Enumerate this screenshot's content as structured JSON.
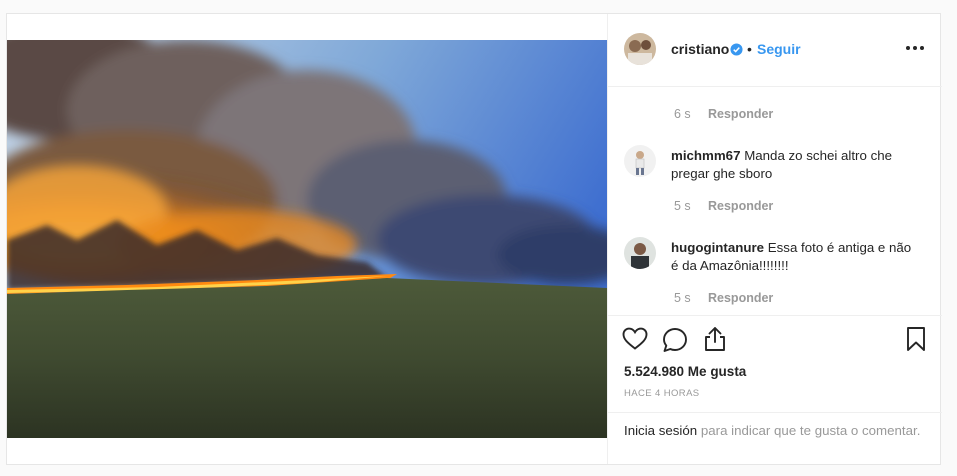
{
  "post": {
    "author": "cristiano",
    "follow_label": "Seguir",
    "dot": "•",
    "likes": "5.524.980 Me gusta",
    "time_ago": "HACE 4 HORAS"
  },
  "comments": [
    {
      "username": "",
      "text": "",
      "time": "6 s",
      "reply_label": "Responder"
    },
    {
      "username": "michmm67",
      "text": "Manda zo schei altro che pregar ghe sboro",
      "time": "5 s",
      "reply_label": "Responder"
    },
    {
      "username": "hugogintanure",
      "text": "Essa foto é antiga e não é da Amazônia!!!!!!!!",
      "time": "5 s",
      "reply_label": "Responder"
    }
  ],
  "login_prompt": {
    "link": "Inicia sesión",
    "rest": " para indicar que te gusta o comentar."
  },
  "icons": [
    "verified-badge-icon",
    "more-options-icon",
    "heart-icon",
    "comment-icon",
    "share-icon",
    "bookmark-icon"
  ],
  "colors": {
    "link_blue": "#3897f0",
    "text": "#262626",
    "muted": "#999999",
    "border": "#efefef"
  }
}
